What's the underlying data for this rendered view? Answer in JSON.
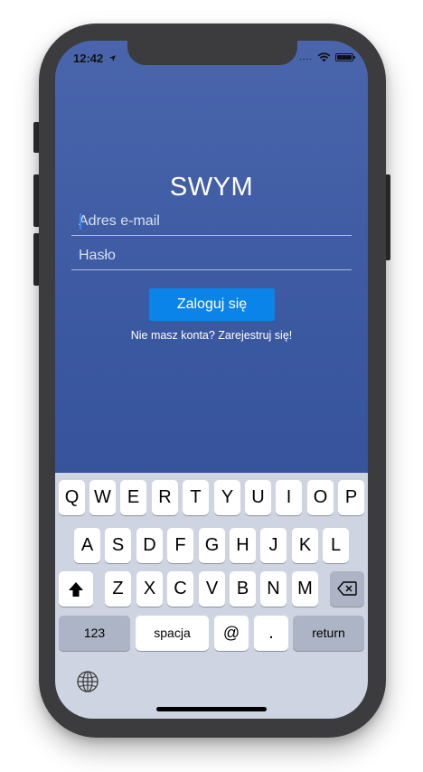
{
  "status_bar": {
    "time": "12:42",
    "location_arrow": "location-arrow-icon",
    "signal": "....",
    "wifi": "wifi-icon",
    "battery": "battery-icon"
  },
  "app": {
    "title": "SWYM"
  },
  "login_form": {
    "email_placeholder": "Adres e-mail",
    "email_value": "",
    "password_placeholder": "Hasło",
    "password_value": "",
    "login_button": "Zaloguj się",
    "register_link": "Nie masz konta? Zarejestruj się!"
  },
  "keyboard": {
    "row1": [
      "Q",
      "W",
      "E",
      "R",
      "T",
      "Y",
      "U",
      "I",
      "O",
      "P"
    ],
    "row2": [
      "A",
      "S",
      "D",
      "F",
      "G",
      "H",
      "J",
      "K",
      "L"
    ],
    "row3": [
      "Z",
      "X",
      "C",
      "V",
      "B",
      "N",
      "M"
    ],
    "numbers_key": "123",
    "space_key": "spacja",
    "at_key": "@",
    "dot_key": ".",
    "return_key": "return",
    "shift_icon": "shift-arrow-icon",
    "backspace_icon": "backspace-icon",
    "globe_icon": "globe-icon"
  },
  "colors": {
    "background_top": "#4a65ac",
    "background_bottom": "#314a95",
    "login_button": "#0a84e8",
    "keyboard_bg": "#cfd4e3",
    "phone_frame": "#3c3c3e"
  }
}
